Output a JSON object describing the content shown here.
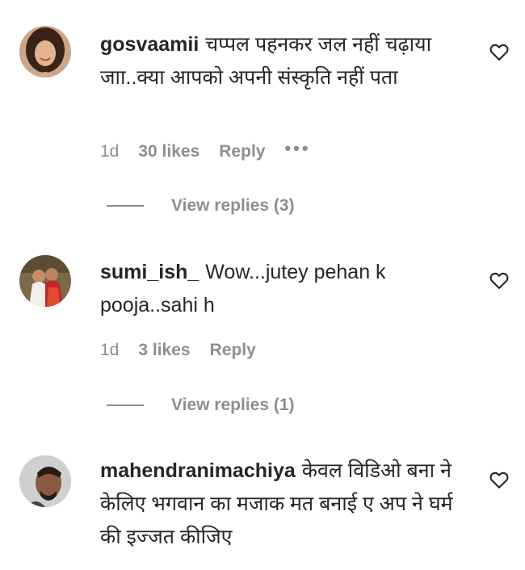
{
  "comments": [
    {
      "username": "gosvaamii",
      "text": "चप्पल पहनकर जल नहीं चढ़ाया जाा..क्या आपको अपनी संस्कृति नहीं पता",
      "time": "1d",
      "likes": "30 likes",
      "reply_label": "Reply",
      "more_label": "•••",
      "view_replies": "View replies (3)"
    },
    {
      "username": "sumi_ish_",
      "text": "Wow...jutey pehan k pooja..sahi h",
      "time": "1d",
      "likes": "3 likes",
      "reply_label": "Reply",
      "view_replies": "View replies (1)"
    },
    {
      "username": "mahendranimachiya",
      "text": "केवल विडिओ बना ने केलिए भगवान का मजाक मत बनाई ए अप ने घर्म की इज्जत कीजिए"
    }
  ],
  "icons": {
    "like": "heart-outline-icon",
    "more": "more-horizontal-icon"
  },
  "colors": {
    "text": "#262626",
    "secondary": "#8e8e8e"
  }
}
